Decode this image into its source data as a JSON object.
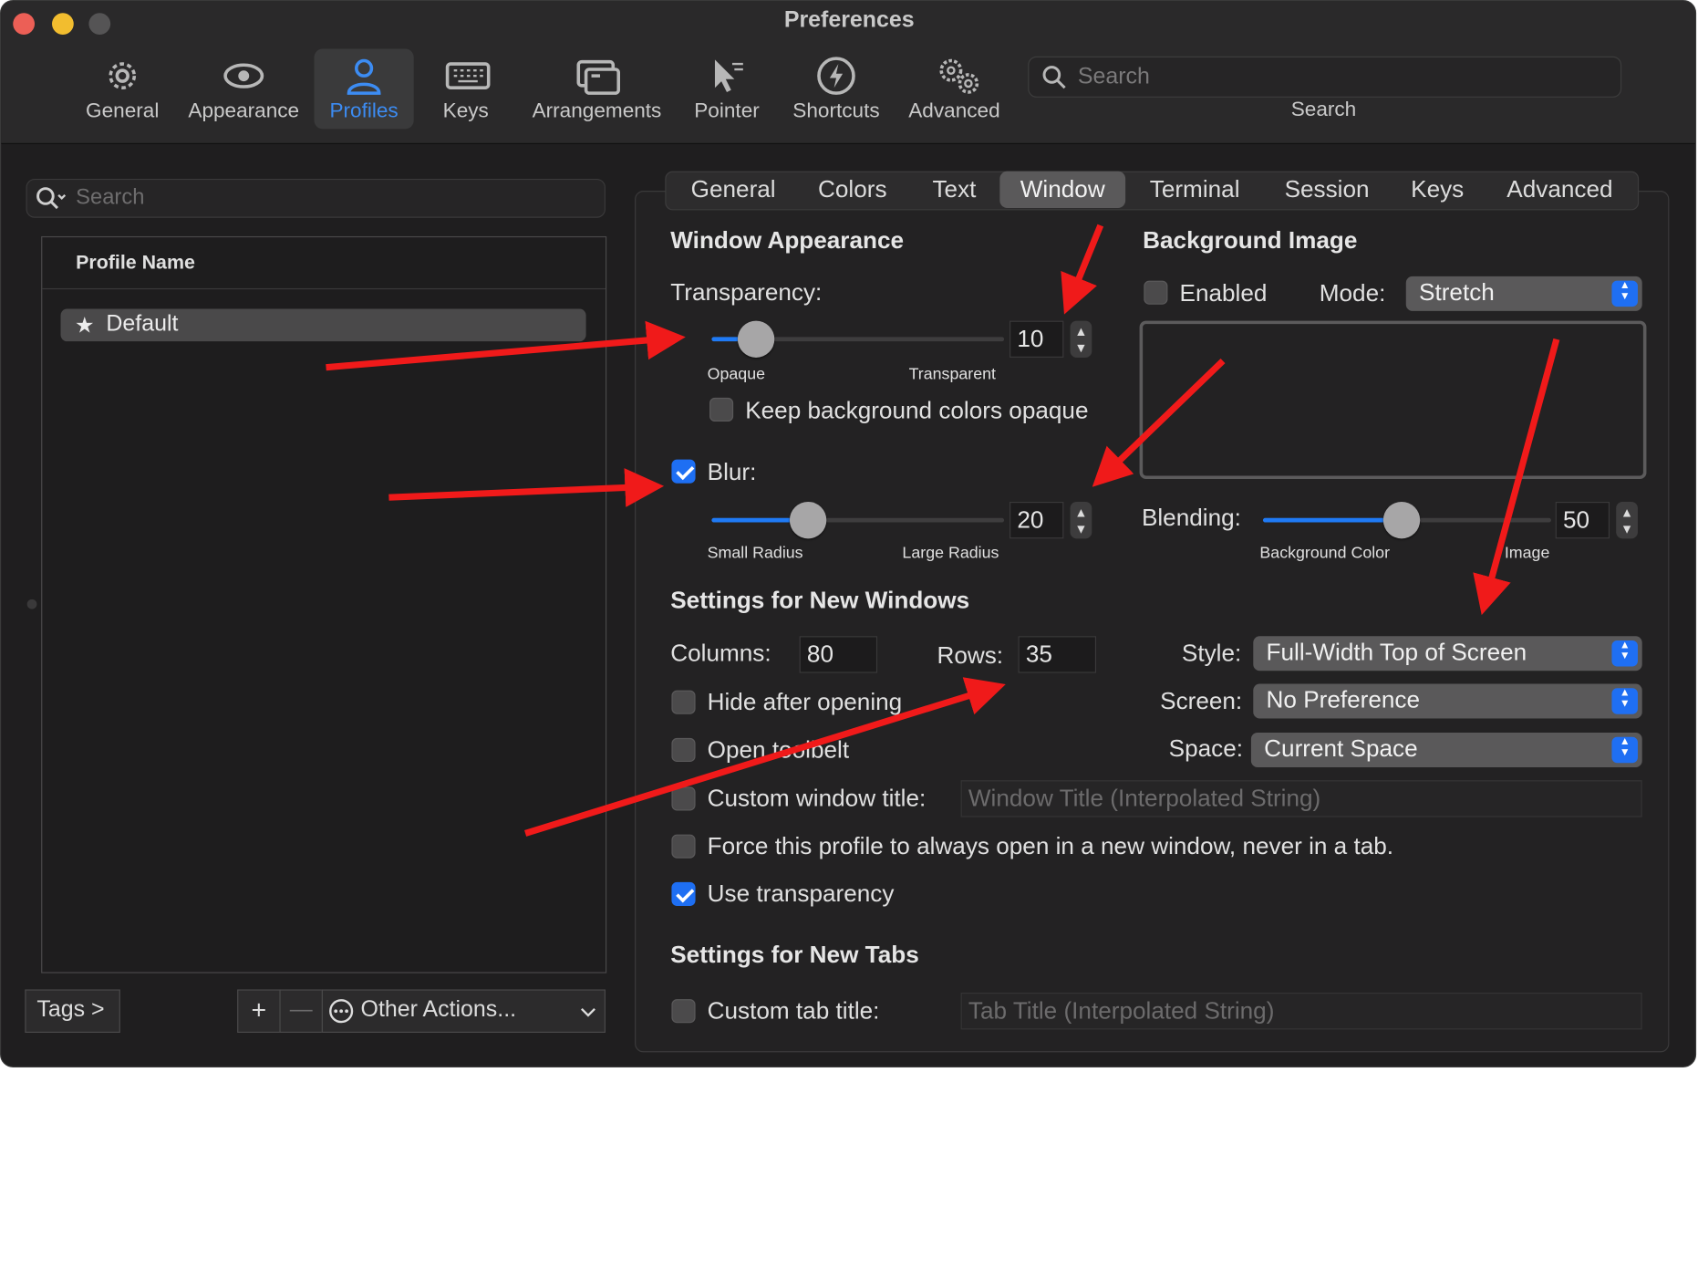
{
  "window": {
    "title": "Preferences"
  },
  "toolbar": {
    "items": [
      {
        "label": "General",
        "icon": "gear-icon"
      },
      {
        "label": "Appearance",
        "icon": "eye-icon"
      },
      {
        "label": "Profiles",
        "icon": "person-icon",
        "selected": true
      },
      {
        "label": "Keys",
        "icon": "keyboard-icon"
      },
      {
        "label": "Arrangements",
        "icon": "windows-icon"
      },
      {
        "label": "Pointer",
        "icon": "pointer-icon"
      },
      {
        "label": "Shortcuts",
        "icon": "lightning-icon"
      },
      {
        "label": "Advanced",
        "icon": "gears-icon"
      }
    ],
    "search": {
      "placeholder": "Search",
      "caption": "Search"
    }
  },
  "sidebar": {
    "search_placeholder": "Search",
    "column_header": "Profile Name",
    "profiles": [
      {
        "name": "Default",
        "icon": "star-icon"
      }
    ],
    "tags_button": "Tags >",
    "add_button": "+",
    "remove_button": "—",
    "other_actions": "Other Actions..."
  },
  "tabs": [
    "General",
    "Colors",
    "Text",
    "Window",
    "Terminal",
    "Session",
    "Keys",
    "Advanced"
  ],
  "selected_tab": "Window",
  "window_appearance": {
    "heading": "Window Appearance",
    "transparency_label": "Transparency:",
    "transparency_value": "10",
    "transparency_fraction": 0.15,
    "transparency_min": "Opaque",
    "transparency_max": "Transparent",
    "keep_bg_opaque": {
      "label": "Keep background colors opaque",
      "checked": false
    },
    "blur": {
      "label": "Blur:",
      "checked": true,
      "value": "20",
      "fraction": 0.33,
      "min": "Small Radius",
      "max": "Large Radius"
    }
  },
  "background_image": {
    "heading": "Background Image",
    "enabled": {
      "label": "Enabled",
      "checked": false
    },
    "mode_label": "Mode:",
    "mode_value": "Stretch",
    "blending_label": "Blending:",
    "blending_value": "50",
    "blending_fraction": 0.48,
    "blending_min": "Background Color",
    "blending_max": "Image"
  },
  "new_windows": {
    "heading": "Settings for New Windows",
    "columns_label": "Columns:",
    "columns_value": "80",
    "rows_label": "Rows:",
    "rows_value": "35",
    "style_label": "Style:",
    "style_value": "Full-Width Top of Screen",
    "screen_label": "Screen:",
    "screen_value": "No Preference",
    "space_label": "Space:",
    "space_value": "Current Space",
    "hide_after_opening": {
      "label": "Hide after opening",
      "checked": false
    },
    "open_toolbelt": {
      "label": "Open toolbelt",
      "checked": false
    },
    "custom_window_title": {
      "label": "Custom window title:",
      "checked": false,
      "placeholder": "Window Title (Interpolated String)"
    },
    "force_new_window": {
      "label": "Force this profile to always open in a new window, never in a tab.",
      "checked": false
    },
    "use_transparency": {
      "label": "Use transparency",
      "checked": true
    }
  },
  "new_tabs": {
    "heading": "Settings for New Tabs",
    "custom_tab_title": {
      "label": "Custom tab title:",
      "checked": false,
      "placeholder": "Tab Title (Interpolated String)"
    }
  },
  "colors": {
    "accent": "#1f7af5",
    "annotation_arrow": "#f01a1a",
    "selected_toolbar": "#3c8cf3"
  }
}
